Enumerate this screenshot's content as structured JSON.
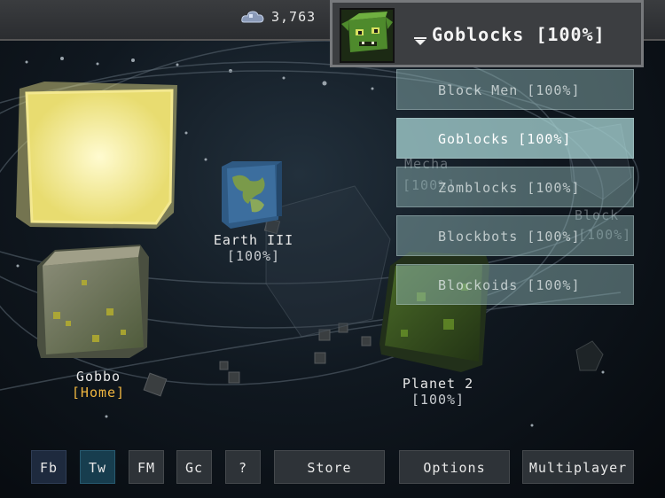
{
  "hud": {
    "credits_icon": "cloud-credits-icon",
    "credits": "3,763"
  },
  "race_selector": {
    "portrait_icon": "goblin-portrait-icon",
    "selected": "Goblocks [100%]"
  },
  "dropdown": {
    "items": [
      {
        "label": "Block Men [100%]"
      },
      {
        "label": "Goblocks [100%]"
      },
      {
        "label": "Zomblocks [100%]"
      },
      {
        "label": "Blockbots [100%]"
      },
      {
        "label": "Blockoids [100%]"
      }
    ]
  },
  "planets": {
    "earth": {
      "name": "Earth III",
      "status": "[100%]"
    },
    "gobbo": {
      "name": "Gobbo",
      "status": "[Home]"
    },
    "planet2": {
      "name": "Planet 2",
      "status": "[100%]"
    },
    "mecha": {
      "name": "Mecha",
      "status": "[100%]"
    },
    "block": {
      "name": "Block",
      "status": "[100%]"
    }
  },
  "bottom_bar": {
    "fb": "Fb",
    "tw": "Tw",
    "fm": "FM",
    "gc": "Gc",
    "help": "?",
    "store": "Store",
    "options": "Options",
    "multiplayer": "Multiplayer"
  },
  "colors": {
    "sun": "#f7f0a0",
    "home_label": "#f0b640",
    "dropdown_active": "#aad7d7"
  }
}
